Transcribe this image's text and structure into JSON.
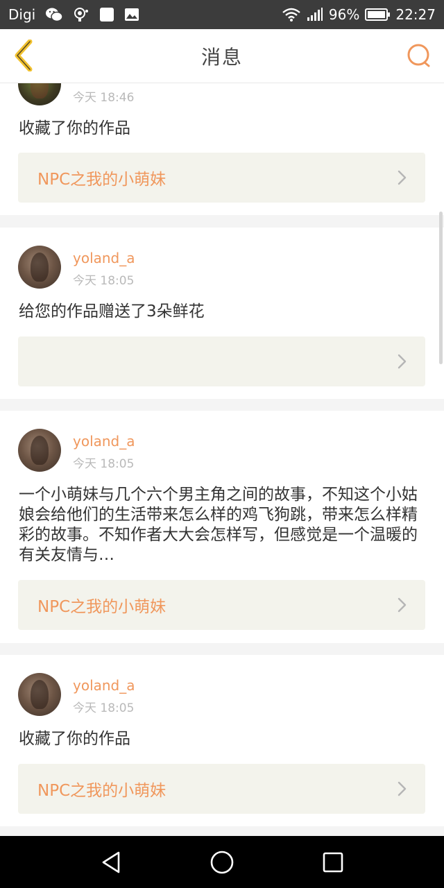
{
  "status_bar": {
    "carrier": "Digi",
    "battery": "96%",
    "time": "22:27"
  },
  "header": {
    "title": "消息"
  },
  "colors": {
    "accent": "#f0975c",
    "work_box_bg": "#f3f3ec",
    "status_bar_bg": "#3c3c3c"
  },
  "messages": [
    {
      "username": "",
      "time": "今天 18:46",
      "content": "收藏了你的作品",
      "work_title": "NPC之我的小萌妹"
    },
    {
      "username": "yoland_a",
      "time": "今天 18:05",
      "content": "给您的作品赠送了3朵鲜花",
      "work_title": ""
    },
    {
      "username": "yoland_a",
      "time": "今天 18:05",
      "content": "一个小萌妹与几个六个男主角之间的故事，不知这个小姑娘会给他们的生活带来怎么样的鸡飞狗跳，带来怎么样精彩的故事。不知作者大大会怎样写，但感觉是一个温暖的有关友情与…",
      "work_title": "NPC之我的小萌妹"
    },
    {
      "username": "yoland_a",
      "time": "今天 18:05",
      "content": "收藏了你的作品",
      "work_title": "NPC之我的小萌妹"
    }
  ],
  "icons": {
    "back": "chevron-left-icon",
    "search": "search-icon",
    "work_arrow": "chevron-right-icon",
    "nav_back": "triangle-back-icon",
    "nav_home": "circle-home-icon",
    "nav_recents": "square-recents-icon"
  }
}
